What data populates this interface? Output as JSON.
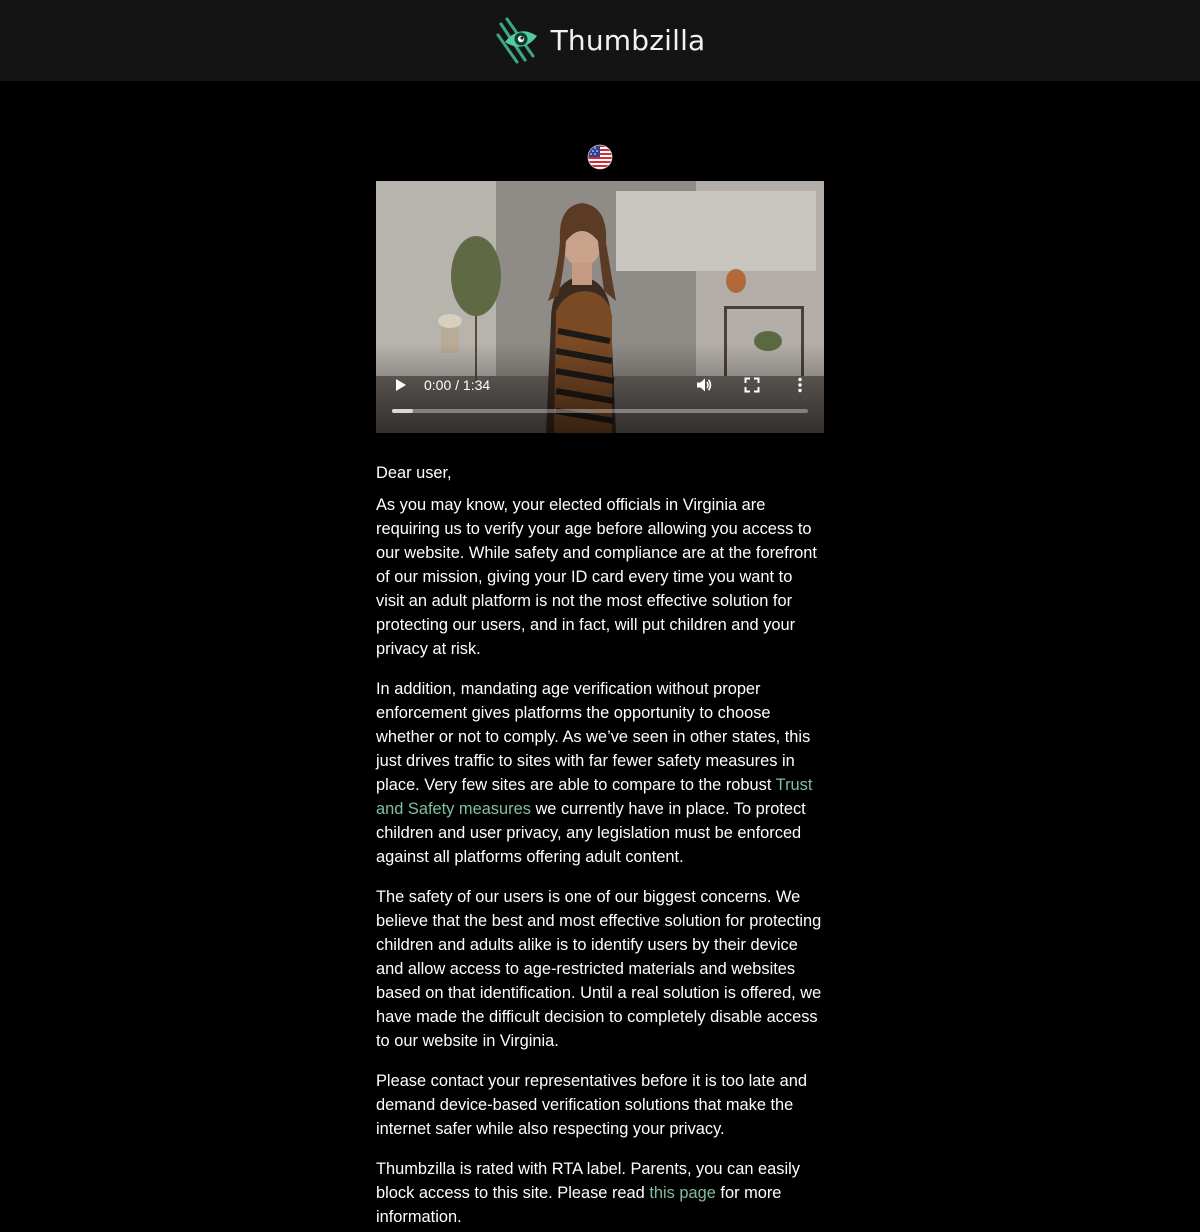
{
  "header": {
    "brand_name": "Thumbzilla",
    "logo_icon": "thumbzilla-eye-claw-icon",
    "brand_color": "#4fbf97"
  },
  "locale": {
    "flag_icon": "us-flag-icon"
  },
  "video": {
    "time_display": "0:00 / 1:34",
    "progress_fraction": 0.05,
    "controls": {
      "play_icon": "play-icon",
      "volume_icon": "volume-icon",
      "fullscreen_icon": "fullscreen-icon",
      "menu_icon": "more-vert-icon"
    }
  },
  "letter": {
    "greeting": "Dear user,",
    "p1": "As you may know, your elected officials in Virginia are requiring us to verify your age before allowing you access to our website. While safety and compliance are at the forefront of our mission, giving your ID card every time you want to visit an adult platform is not the most effective solution for protecting our users, and in fact, will put children and your privacy at risk.",
    "p2_before": "In addition, mandating age verification without proper enforcement gives platforms the opportunity to choose whether or not to comply. As we’ve seen in other states, this just drives traffic to sites with far fewer safety measures in place. Very few sites are able to compare to the robust ",
    "p2_link": "Trust and Safety measures",
    "p2_after": " we currently have in place. To protect children and user privacy, any legislation must be enforced against all platforms offering adult content.",
    "p3": "The safety of our users is one of our biggest concerns. We believe that the best and most effective solution for protecting children and adults alike is to identify users by their device and allow access to age-restricted materials and websites based on that identification. Until a real solution is offered, we have made the difficult decision to completely disable access to our website in Virginia.",
    "p4": "Please contact your representatives before it is too late and demand device-based verification solutions that make the internet safer while also respecting your privacy.",
    "p5_before": "Thumbzilla is rated with RTA label. Parents, you can easily block access to this site. Please read ",
    "p5_link": "this page",
    "p5_after": " for more information.",
    "link_color": "#7fbf9f"
  }
}
